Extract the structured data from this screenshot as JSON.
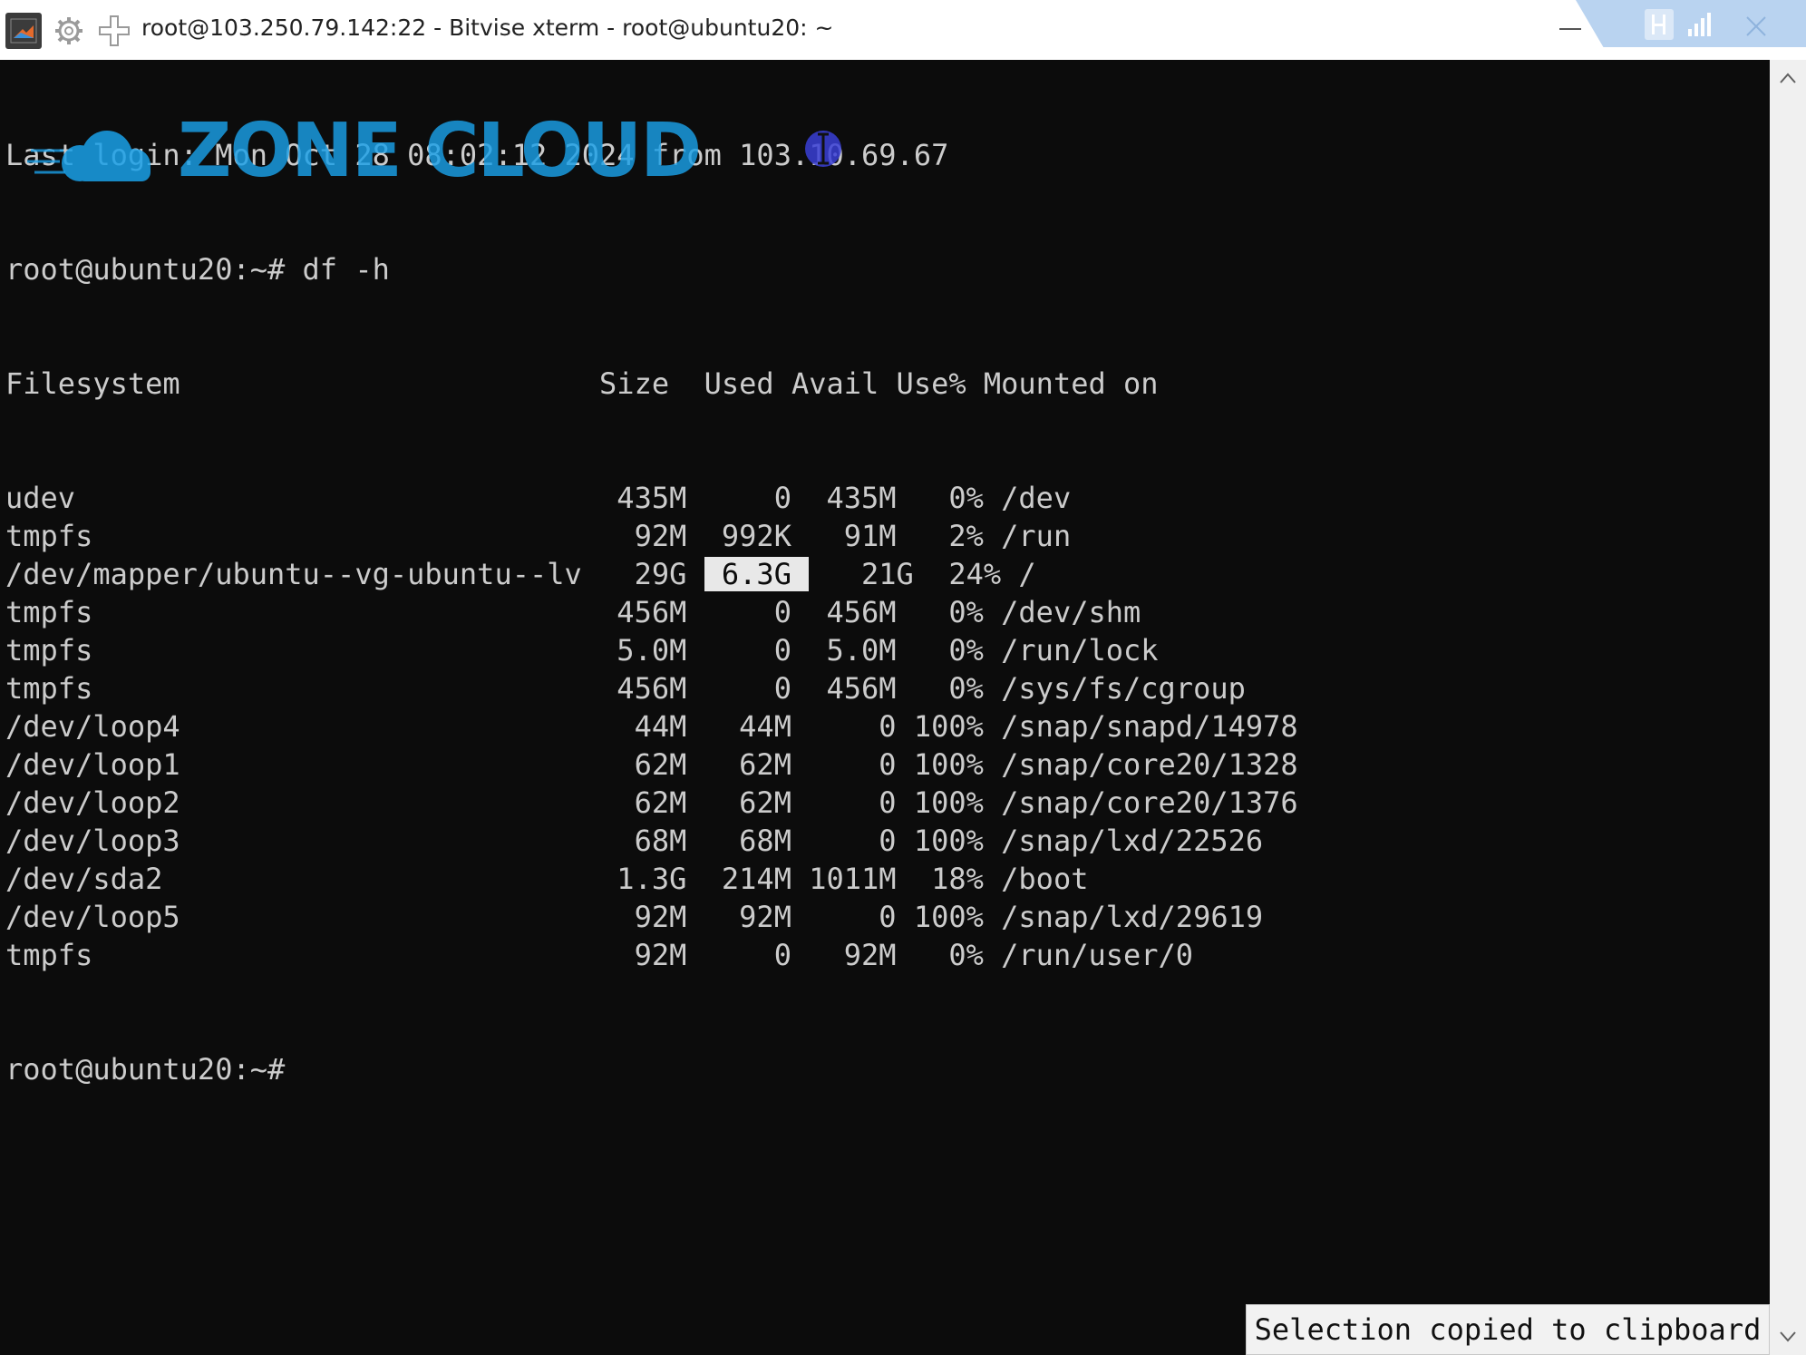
{
  "window": {
    "title": "root@103.250.79.142:22 - Bitvise xterm - root@ubuntu20: ~",
    "icons": [
      "terminal-app-icon",
      "gear-icon",
      "plus-icon",
      "minimize-icon",
      "signal-icon",
      "close-icon"
    ]
  },
  "watermark": {
    "text": "ZONE CLOUD",
    "color": "#1aa0e8"
  },
  "terminal": {
    "background": "#0c0c0c",
    "foreground": "#cccccc",
    "last_login": "Last login: Mon Oct 28 08:02:12 2024 from 103.10.69.67",
    "prompt": "root@ubuntu20:~#",
    "command": "df -h",
    "header": {
      "filesystem": "Filesystem",
      "size": "Size",
      "used": "Used",
      "avail": "Avail",
      "use_pct": "Use%",
      "mounted_on": "Mounted on"
    },
    "rows": [
      {
        "fs": "udev",
        "size": "435M",
        "used": "0",
        "avail": "435M",
        "pct": "0%",
        "mount": "/dev"
      },
      {
        "fs": "tmpfs",
        "size": "92M",
        "used": "992K",
        "avail": "91M",
        "pct": "2%",
        "mount": "/run"
      },
      {
        "fs": "/dev/mapper/ubuntu--vg-ubuntu--lv",
        "size": "29G",
        "used": "6.3G",
        "avail": "21G",
        "pct": "24%",
        "mount": "/"
      },
      {
        "fs": "tmpfs",
        "size": "456M",
        "used": "0",
        "avail": "456M",
        "pct": "0%",
        "mount": "/dev/shm"
      },
      {
        "fs": "tmpfs",
        "size": "5.0M",
        "used": "0",
        "avail": "5.0M",
        "pct": "0%",
        "mount": "/run/lock"
      },
      {
        "fs": "tmpfs",
        "size": "456M",
        "used": "0",
        "avail": "456M",
        "pct": "0%",
        "mount": "/sys/fs/cgroup"
      },
      {
        "fs": "/dev/loop4",
        "size": "44M",
        "used": "44M",
        "avail": "0",
        "pct": "100%",
        "mount": "/snap/snapd/14978"
      },
      {
        "fs": "/dev/loop1",
        "size": "62M",
        "used": "62M",
        "avail": "0",
        "pct": "100%",
        "mount": "/snap/core20/1328"
      },
      {
        "fs": "/dev/loop2",
        "size": "62M",
        "used": "62M",
        "avail": "0",
        "pct": "100%",
        "mount": "/snap/core20/1376"
      },
      {
        "fs": "/dev/loop3",
        "size": "68M",
        "used": "68M",
        "avail": "0",
        "pct": "100%",
        "mount": "/snap/lxd/22526"
      },
      {
        "fs": "/dev/sda2",
        "size": "1.3G",
        "used": "214M",
        "avail": "1011M",
        "pct": "18%",
        "mount": "/boot"
      },
      {
        "fs": "/dev/loop5",
        "size": "92M",
        "used": "92M",
        "avail": "0",
        "pct": "100%",
        "mount": "/snap/lxd/29619"
      },
      {
        "fs": "tmpfs",
        "size": "92M",
        "used": "0",
        "avail": "92M",
        "pct": "0%",
        "mount": "/run/user/0"
      }
    ],
    "selected_value": "6.3G"
  },
  "status": {
    "toast": "Selection copied to clipboard"
  }
}
